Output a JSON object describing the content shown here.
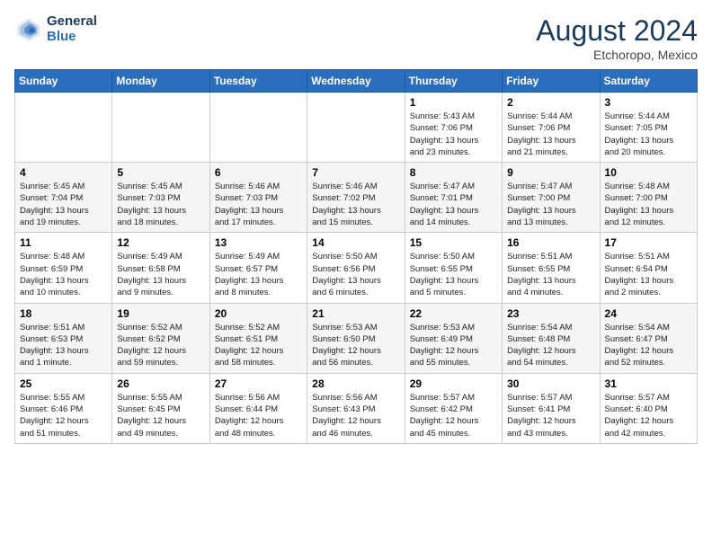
{
  "header": {
    "logo_line1": "General",
    "logo_line2": "Blue",
    "month_year": "August 2024",
    "location": "Etchoropo, Mexico"
  },
  "days_of_week": [
    "Sunday",
    "Monday",
    "Tuesday",
    "Wednesday",
    "Thursday",
    "Friday",
    "Saturday"
  ],
  "weeks": [
    [
      {
        "day": "",
        "info": ""
      },
      {
        "day": "",
        "info": ""
      },
      {
        "day": "",
        "info": ""
      },
      {
        "day": "",
        "info": ""
      },
      {
        "day": "1",
        "info": "Sunrise: 5:43 AM\nSunset: 7:06 PM\nDaylight: 13 hours\nand 23 minutes."
      },
      {
        "day": "2",
        "info": "Sunrise: 5:44 AM\nSunset: 7:06 PM\nDaylight: 13 hours\nand 21 minutes."
      },
      {
        "day": "3",
        "info": "Sunrise: 5:44 AM\nSunset: 7:05 PM\nDaylight: 13 hours\nand 20 minutes."
      }
    ],
    [
      {
        "day": "4",
        "info": "Sunrise: 5:45 AM\nSunset: 7:04 PM\nDaylight: 13 hours\nand 19 minutes."
      },
      {
        "day": "5",
        "info": "Sunrise: 5:45 AM\nSunset: 7:03 PM\nDaylight: 13 hours\nand 18 minutes."
      },
      {
        "day": "6",
        "info": "Sunrise: 5:46 AM\nSunset: 7:03 PM\nDaylight: 13 hours\nand 17 minutes."
      },
      {
        "day": "7",
        "info": "Sunrise: 5:46 AM\nSunset: 7:02 PM\nDaylight: 13 hours\nand 15 minutes."
      },
      {
        "day": "8",
        "info": "Sunrise: 5:47 AM\nSunset: 7:01 PM\nDaylight: 13 hours\nand 14 minutes."
      },
      {
        "day": "9",
        "info": "Sunrise: 5:47 AM\nSunset: 7:00 PM\nDaylight: 13 hours\nand 13 minutes."
      },
      {
        "day": "10",
        "info": "Sunrise: 5:48 AM\nSunset: 7:00 PM\nDaylight: 13 hours\nand 12 minutes."
      }
    ],
    [
      {
        "day": "11",
        "info": "Sunrise: 5:48 AM\nSunset: 6:59 PM\nDaylight: 13 hours\nand 10 minutes."
      },
      {
        "day": "12",
        "info": "Sunrise: 5:49 AM\nSunset: 6:58 PM\nDaylight: 13 hours\nand 9 minutes."
      },
      {
        "day": "13",
        "info": "Sunrise: 5:49 AM\nSunset: 6:57 PM\nDaylight: 13 hours\nand 8 minutes."
      },
      {
        "day": "14",
        "info": "Sunrise: 5:50 AM\nSunset: 6:56 PM\nDaylight: 13 hours\nand 6 minutes."
      },
      {
        "day": "15",
        "info": "Sunrise: 5:50 AM\nSunset: 6:55 PM\nDaylight: 13 hours\nand 5 minutes."
      },
      {
        "day": "16",
        "info": "Sunrise: 5:51 AM\nSunset: 6:55 PM\nDaylight: 13 hours\nand 4 minutes."
      },
      {
        "day": "17",
        "info": "Sunrise: 5:51 AM\nSunset: 6:54 PM\nDaylight: 13 hours\nand 2 minutes."
      }
    ],
    [
      {
        "day": "18",
        "info": "Sunrise: 5:51 AM\nSunset: 6:53 PM\nDaylight: 13 hours\nand 1 minute."
      },
      {
        "day": "19",
        "info": "Sunrise: 5:52 AM\nSunset: 6:52 PM\nDaylight: 12 hours\nand 59 minutes."
      },
      {
        "day": "20",
        "info": "Sunrise: 5:52 AM\nSunset: 6:51 PM\nDaylight: 12 hours\nand 58 minutes."
      },
      {
        "day": "21",
        "info": "Sunrise: 5:53 AM\nSunset: 6:50 PM\nDaylight: 12 hours\nand 56 minutes."
      },
      {
        "day": "22",
        "info": "Sunrise: 5:53 AM\nSunset: 6:49 PM\nDaylight: 12 hours\nand 55 minutes."
      },
      {
        "day": "23",
        "info": "Sunrise: 5:54 AM\nSunset: 6:48 PM\nDaylight: 12 hours\nand 54 minutes."
      },
      {
        "day": "24",
        "info": "Sunrise: 5:54 AM\nSunset: 6:47 PM\nDaylight: 12 hours\nand 52 minutes."
      }
    ],
    [
      {
        "day": "25",
        "info": "Sunrise: 5:55 AM\nSunset: 6:46 PM\nDaylight: 12 hours\nand 51 minutes."
      },
      {
        "day": "26",
        "info": "Sunrise: 5:55 AM\nSunset: 6:45 PM\nDaylight: 12 hours\nand 49 minutes."
      },
      {
        "day": "27",
        "info": "Sunrise: 5:56 AM\nSunset: 6:44 PM\nDaylight: 12 hours\nand 48 minutes."
      },
      {
        "day": "28",
        "info": "Sunrise: 5:56 AM\nSunset: 6:43 PM\nDaylight: 12 hours\nand 46 minutes."
      },
      {
        "day": "29",
        "info": "Sunrise: 5:57 AM\nSunset: 6:42 PM\nDaylight: 12 hours\nand 45 minutes."
      },
      {
        "day": "30",
        "info": "Sunrise: 5:57 AM\nSunset: 6:41 PM\nDaylight: 12 hours\nand 43 minutes."
      },
      {
        "day": "31",
        "info": "Sunrise: 5:57 AM\nSunset: 6:40 PM\nDaylight: 12 hours\nand 42 minutes."
      }
    ]
  ]
}
